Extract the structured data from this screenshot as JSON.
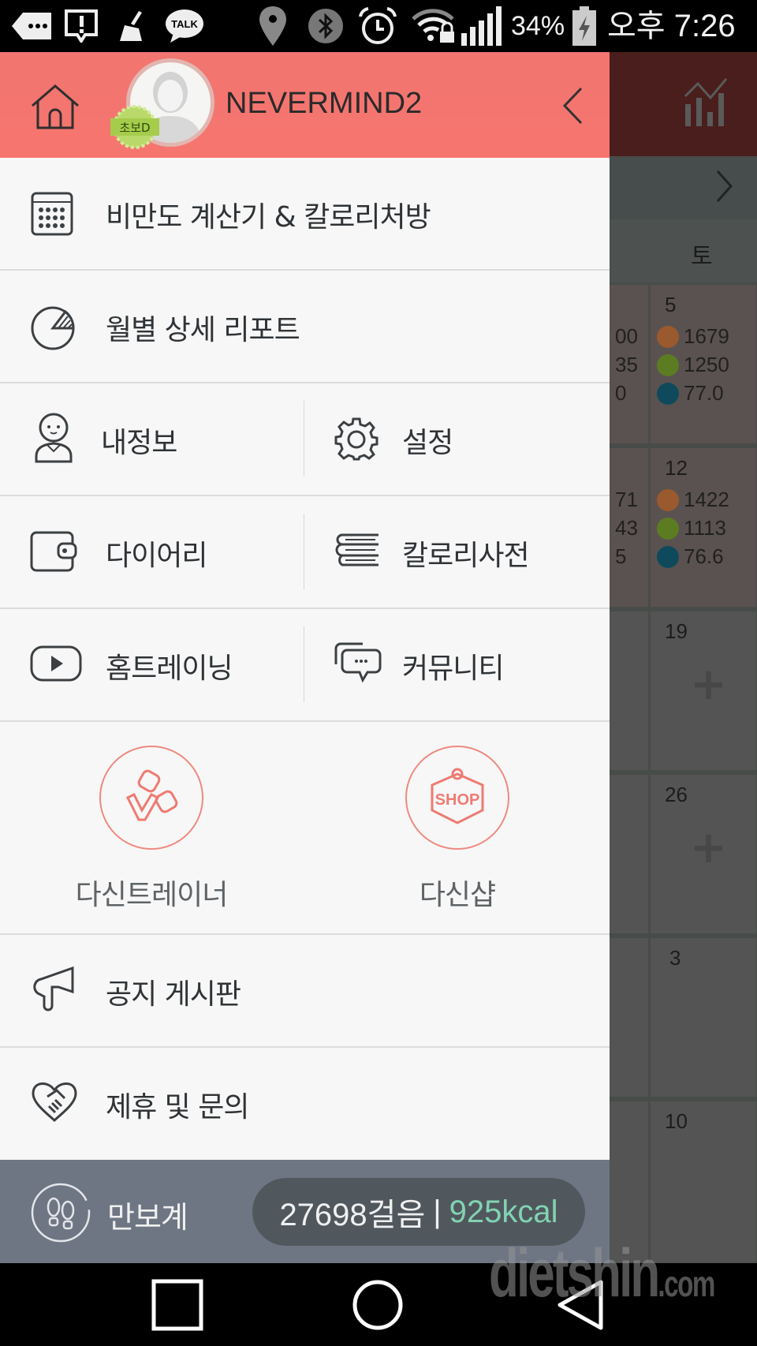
{
  "status_bar": {
    "battery": "34%",
    "time": "오후 7:26",
    "icons": [
      "more-notifications-icon",
      "alert-icon",
      "cleaner-icon",
      "kakaotalk-icon",
      "location-icon",
      "bluetooth-icon",
      "alarm-icon",
      "wifi-lock-icon",
      "signal-icon",
      "battery-charging-icon"
    ],
    "talk_label": "TALK"
  },
  "drawer": {
    "header": {
      "username": "NEVERMIND2",
      "level_badge": "초보D",
      "accent_color": "#f57570"
    },
    "menu": {
      "bmi_calculator": "비만도 계산기 & 칼로리처방",
      "monthly_report": "월별 상세 리포트",
      "my_info": "내정보",
      "settings": "설정",
      "diary": "다이어리",
      "calorie_dictionary": "칼로리사전",
      "home_training": "홈트레이닝",
      "community": "커뮤니티",
      "dashin_trainer": "다신트레이너",
      "dashin_shop": "다신샵",
      "shop_icon_text": "SHOP",
      "notice_board": "공지 게시판",
      "partnership_inquiry": "제휴 및 문의"
    },
    "pedometer": {
      "label": "만보계",
      "steps": "27698걸음",
      "separator": "|",
      "kcal": "925kcal",
      "kcal_color": "#82d3b1"
    }
  },
  "background_calendar": {
    "day_header": "토",
    "cells": [
      {
        "date": "5",
        "intake": "1679",
        "burned": "1250",
        "weight": "77.0"
      },
      {
        "date": "12",
        "intake": "1422",
        "burned": "1113",
        "weight": "76.6"
      },
      {
        "date": "19"
      },
      {
        "date": "26"
      },
      {
        "date": "3"
      },
      {
        "date": "10"
      }
    ],
    "partial_left": [
      [
        "00",
        "35",
        "0"
      ],
      [
        "71",
        "43",
        "5"
      ]
    ],
    "add_symbol": "+"
  },
  "watermark": {
    "main": "dietshin",
    "suffix": ".com"
  }
}
